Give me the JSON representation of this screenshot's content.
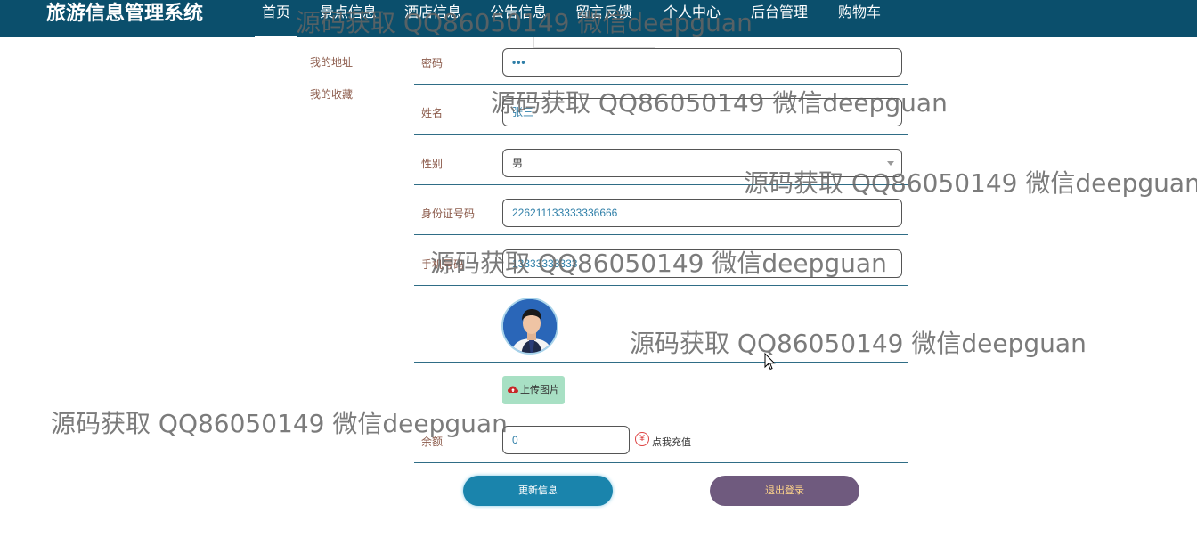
{
  "app": {
    "title": "旅游信息管理系统"
  },
  "nav": {
    "items": [
      {
        "label": "首页",
        "active": true
      },
      {
        "label": "景点信息"
      },
      {
        "label": "酒店信息"
      },
      {
        "label": "公告信息"
      },
      {
        "label": "留言反馈"
      },
      {
        "label": "个人中心"
      },
      {
        "label": "后台管理"
      },
      {
        "label": "购物车"
      }
    ]
  },
  "sidebar": {
    "items": [
      {
        "label": "我的地址"
      },
      {
        "label": "我的收藏"
      }
    ]
  },
  "form": {
    "password": {
      "label": "密码",
      "value": "•••"
    },
    "name": {
      "label": "姓名",
      "value": "张三"
    },
    "gender": {
      "label": "性别",
      "value": "男"
    },
    "id_card": {
      "label": "身份证号码",
      "value": "226211133333336666"
    },
    "phone": {
      "label": "手机号码",
      "value": "13333333333"
    },
    "upload_label": "上传图片",
    "balance": {
      "label": "余额",
      "value": "0"
    },
    "recharge_label": "点我充值",
    "yen_symbol": "¥",
    "update_button": "更新信息",
    "logout_button": "退出登录"
  },
  "watermark": {
    "text": "源码获取 QQ86050149 微信deepguan"
  },
  "colors": {
    "nav_bg": "#0b4f6c",
    "update_button": "#1a84ac",
    "logout_button": "#6f5a7e",
    "upload_button": "#a8e0c4"
  }
}
